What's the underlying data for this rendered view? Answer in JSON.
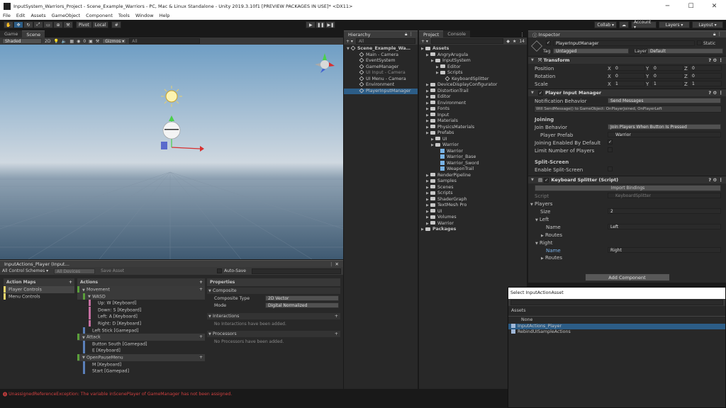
{
  "window": {
    "title": "InputSystem_Warriors_Project - Scene_Example_Warriors - PC, Mac & Linux Standalone - Unity 2019.3.10f1 [PREVIEW PACKAGES IN USE]* <DX11>",
    "controls": [
      "─",
      "☐",
      "✕"
    ]
  },
  "menu": [
    "File",
    "Edit",
    "Assets",
    "GameObject",
    "Component",
    "Tools",
    "Window",
    "Help"
  ],
  "toolbar": {
    "pivot": "Pivot",
    "local": "Local",
    "collab": "Collab ▾",
    "account": "Account ▾",
    "layers": "Layers ▾",
    "layout": "Layout ▾"
  },
  "scene": {
    "tabs": [
      "Game",
      "Scene"
    ],
    "shading": "Shaded",
    "mode2d": "2D",
    "gizmos": "Gizmos ▾",
    "search_placeholder": "All",
    "zero": "0"
  },
  "hierarchy": {
    "tab": "Hierarchy",
    "search_placeholder": "All",
    "items": [
      {
        "label": "Scene_Example_Wa…",
        "indent": 0,
        "icon": "unity-scene-icon",
        "bold": true
      },
      {
        "label": "Main - Camera",
        "indent": 1,
        "icon": "gameobject-icon"
      },
      {
        "label": "EventSystem",
        "indent": 1,
        "icon": "gameobject-icon"
      },
      {
        "label": "GameManager",
        "indent": 1,
        "icon": "gameobject-icon"
      },
      {
        "label": "UI Input - Camera",
        "indent": 1,
        "icon": "gameobject-icon",
        "dim": true
      },
      {
        "label": "UI Menu - Camera",
        "indent": 1,
        "icon": "gameobject-icon"
      },
      {
        "label": "Environment",
        "indent": 1,
        "icon": "gameobject-icon"
      },
      {
        "label": "PlayerInputManager",
        "indent": 1,
        "icon": "gameobject-icon",
        "selected": true
      }
    ]
  },
  "project": {
    "tabs": [
      "Project",
      "Console"
    ],
    "badge": "14",
    "items": [
      {
        "label": "Assets",
        "indent": 0,
        "bold": true
      },
      {
        "label": "AngryArugula",
        "indent": 1
      },
      {
        "label": "InputSystem",
        "indent": 2
      },
      {
        "label": "Editor",
        "indent": 3
      },
      {
        "label": "Scripts",
        "indent": 3
      },
      {
        "label": "KeyboardSplitter",
        "indent": 4,
        "file": true
      },
      {
        "label": "DeviceDisplayConfigurator",
        "indent": 1
      },
      {
        "label": "DistortionTrail",
        "indent": 1
      },
      {
        "label": "Editor",
        "indent": 1
      },
      {
        "label": "Environment",
        "indent": 1
      },
      {
        "label": "Fonts",
        "indent": 1
      },
      {
        "label": "Input",
        "indent": 1
      },
      {
        "label": "Materials",
        "indent": 1
      },
      {
        "label": "PhysicsMaterials",
        "indent": 1
      },
      {
        "label": "Prefabs",
        "indent": 1
      },
      {
        "label": "UI",
        "indent": 2
      },
      {
        "label": "Warrior",
        "indent": 2
      },
      {
        "label": "Warrior",
        "indent": 3,
        "prefab": true
      },
      {
        "label": "Warrior_Base",
        "indent": 3,
        "prefab": true
      },
      {
        "label": "Warrior_Sword",
        "indent": 3,
        "prefab": true
      },
      {
        "label": "WeaponTrail",
        "indent": 3,
        "prefab": true
      },
      {
        "label": "RenderPipeline",
        "indent": 1
      },
      {
        "label": "Samples",
        "indent": 1
      },
      {
        "label": "Scenes",
        "indent": 1
      },
      {
        "label": "Scripts",
        "indent": 1
      },
      {
        "label": "ShaderGraph",
        "indent": 1
      },
      {
        "label": "TextMesh Pro",
        "indent": 1
      },
      {
        "label": "UI",
        "indent": 1
      },
      {
        "label": "Volumes",
        "indent": 1
      },
      {
        "label": "Warrior",
        "indent": 1
      },
      {
        "label": "Packages",
        "indent": 0,
        "bold": true
      }
    ]
  },
  "inspector": {
    "tab": "Inspector",
    "object_name": "PlayerInputManager",
    "static_label": "Static",
    "tag_label": "Tag",
    "tag_value": "Untagged",
    "layer_label": "Layer",
    "layer_value": "Default",
    "transform": {
      "title": "Transform",
      "rows": [
        {
          "label": "Position",
          "x": "0",
          "y": "0",
          "z": "0"
        },
        {
          "label": "Rotation",
          "x": "0",
          "y": "0",
          "z": "0"
        },
        {
          "label": "Scale",
          "x": "1",
          "y": "1",
          "z": "1"
        }
      ],
      "axis": [
        "X",
        "Y",
        "Z"
      ]
    },
    "pim": {
      "title": "Player Input Manager",
      "notif_label": "Notification Behavior",
      "notif_value": "Send Messages",
      "info": "Will SendMessage() to GameObject: OnPlayerJoined, OnPlayerLeft",
      "joining": "Joining",
      "join_beh_label": "Join Behavior",
      "join_beh_value": "Join Players When Button Is Pressed",
      "prefab_label": "Player Prefab",
      "prefab_value": "Warrior",
      "enabled_label": "Joining Enabled By Default",
      "enabled_check": "✓",
      "limit_label": "Limit Number of Players",
      "split": "Split-Screen",
      "split_label": "Enable Split-Screen"
    },
    "ks": {
      "title": "Keyboard Splitter (Script)",
      "import": "Import Bindings",
      "script_label": "Script",
      "script_value": "KeyboardSplitter",
      "players": "Players",
      "size_label": "Size",
      "size_value": "2",
      "left": "Left",
      "name_label": "Name",
      "left_name": "Left",
      "routes": "Routes",
      "right": "Right",
      "right_name": "Right"
    },
    "add_component": "Add Component"
  },
  "input_actions": {
    "title": "InputActions_Player (Input…",
    "schemes": "All Control Schemes ▾",
    "devices": "All Devices",
    "save": "Save Asset",
    "autosave": "Auto-Save",
    "maps_header": "Action Maps",
    "actions_header": "Actions",
    "props_header": "Properties",
    "maps": [
      "Player Controls",
      "Menu Controls"
    ],
    "actions": [
      {
        "label": "Movement",
        "type": "action",
        "indent": 0
      },
      {
        "label": "WASD",
        "type": "composite",
        "indent": 1
      },
      {
        "label": "Up: W [Keyboard]",
        "type": "part",
        "indent": 2
      },
      {
        "label": "Down: S [Keyboard]",
        "type": "part",
        "indent": 2
      },
      {
        "label": "Left: A [Keyboard]",
        "type": "part",
        "indent": 2
      },
      {
        "label": "Right: D [Keyboard]",
        "type": "part",
        "indent": 2
      },
      {
        "label": "Left Stick [Gamepad]",
        "type": "binding",
        "indent": 1
      },
      {
        "label": "Attack",
        "type": "action",
        "indent": 0
      },
      {
        "label": "Button South [Gamepad]",
        "type": "binding",
        "indent": 1
      },
      {
        "label": "E [Keyboard]",
        "type": "binding",
        "indent": 1
      },
      {
        "label": "OpenPauseMenu",
        "type": "action",
        "indent": 0
      },
      {
        "label": "M [Keyboard]",
        "type": "binding",
        "indent": 1
      },
      {
        "label": "Start [Gamepad]",
        "type": "binding",
        "indent": 1
      }
    ],
    "props": {
      "composite": "Composite",
      "ctype_label": "Composite Type",
      "ctype_value": "2D Vector",
      "mode_label": "Mode",
      "mode_value": "Digital Normalized",
      "interactions": "Interactions",
      "no_inter": "No Interactions have been added.",
      "processors": "Processors",
      "no_proc": "No Processors have been added."
    }
  },
  "picker": {
    "title": "Select InputActionAsset",
    "section": "Assets",
    "items": [
      "None",
      "InputActions_Player",
      "RebindUISampleActions"
    ],
    "selected": 1
  },
  "status": {
    "error": "UnassignedReferenceException: The variable inScenePlayer of GameManager has not been assigned."
  },
  "colors": {
    "accent": "#2c5d87",
    "panel": "#282828",
    "error": "#d04040",
    "action_bar": "#5a9e3a",
    "part_bar": "#c46fa0",
    "map_bar": "#e8d36a"
  }
}
